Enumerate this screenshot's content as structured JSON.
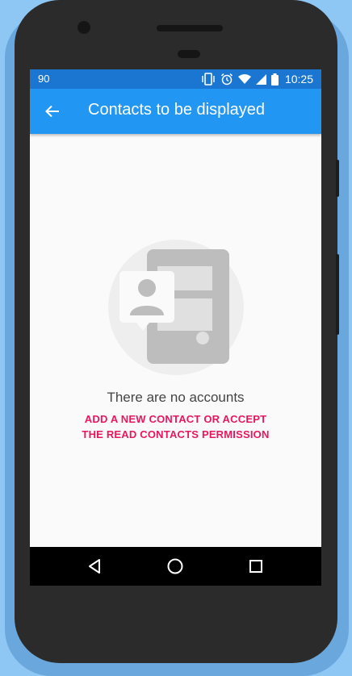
{
  "status_bar": {
    "left_text": "90",
    "time": "10:25",
    "icons": [
      "vibrate-icon",
      "alarm-icon",
      "wifi-icon",
      "signal-icon",
      "battery-icon"
    ]
  },
  "app_bar": {
    "back_icon": "arrow-back-icon",
    "title": "Contacts to be displayed",
    "color": "#2196f3",
    "status_color": "#1b76d2"
  },
  "empty_state": {
    "illustration": "contact-device-icon",
    "title": "There are no accounts",
    "action_line_1": "ADD A NEW CONTACT OR ACCEPT",
    "action_line_2": "THE READ CONTACTS PERMISSION",
    "action_color": "#e8175d"
  },
  "nav_bar": {
    "buttons": [
      "back-triangle-icon",
      "home-circle-icon",
      "recents-square-icon"
    ]
  }
}
